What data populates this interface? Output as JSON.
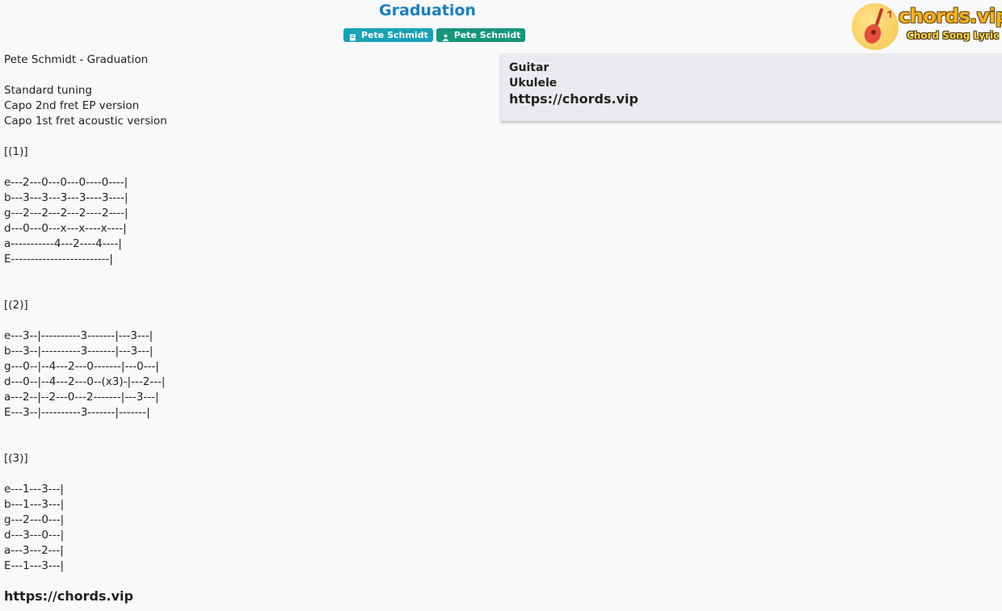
{
  "song": {
    "title": "Graduation",
    "tags": [
      {
        "label": "Pete Schmidt",
        "icon": "book-icon"
      },
      {
        "label": "Pete Schmidt",
        "icon": "user-icon"
      }
    ]
  },
  "logo": {
    "name": "chords.vip",
    "tagline": "Chord Song Lyric"
  },
  "lyrics": {
    "text": "Pete Schmidt - Graduation\n\nStandard tuning\nCapo 2nd fret EP version\nCapo 1st fret acoustic version\n\n[(1)]\n\ne---2---0---0---0----0----|\nb---3---3---3---3----3----|\ng---2---2---2---2----2----|\nd---0---0---x---x----x----|\na-----------4---2----4----|\nE-------------------------|\n\n\n[(2)]\n\ne---3--|----------3-------|---3---|\nb---3--|----------3-------|---3---|\ng---0--|--4---2---0-------|---0---|\nd---0--|--4---2---0--(x3)-|---2---|\na---2--|--2---0---2-------|---3---|\nE---3--|----------3-------|-------|\n\n\n[(3)]\n\ne---1---3---|\nb---1---3---|\ng---2---0---|\nd---3---0---|\na---3---2---|\nE---1---3---|"
  },
  "footer": {
    "url": "https://chords.vip"
  },
  "instruments": {
    "items": [
      "Guitar",
      "Ukulele"
    ],
    "url": "https://chords.vip"
  },
  "colors": {
    "title": "#1a7fc1",
    "tag_book": "#17a2b8",
    "tag_artist": "#15967b",
    "panel_bg": "#e9ebee"
  }
}
